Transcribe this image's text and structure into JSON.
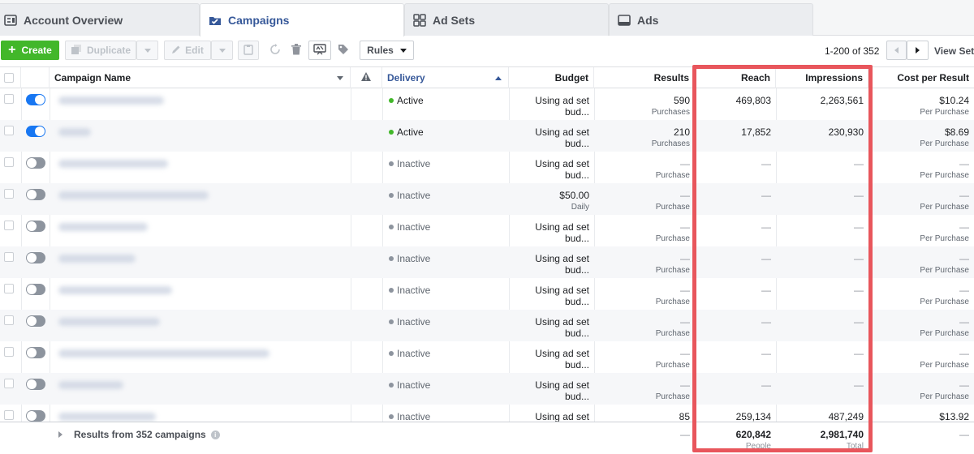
{
  "tabs": [
    {
      "label": "Account Overview",
      "icon": "account-overview-icon"
    },
    {
      "label": "Campaigns",
      "icon": "campaigns-icon"
    },
    {
      "label": "Ad Sets",
      "icon": "ad-sets-icon"
    },
    {
      "label": "Ads",
      "icon": "ads-icon"
    }
  ],
  "toolbar": {
    "create": "Create",
    "duplicate": "Duplicate",
    "edit": "Edit",
    "rules": "Rules",
    "pager": "1-200 of 352",
    "view_setup": "View Setup"
  },
  "columns": {
    "name": "Campaign Name",
    "delivery": "Delivery",
    "budget": "Budget",
    "results": "Results",
    "reach": "Reach",
    "impressions": "Impressions",
    "cost": "Cost per Result"
  },
  "rows": [
    {
      "on": true,
      "name_w": 130,
      "status": "Active",
      "budget": "Using ad set bud...",
      "budget_sub": "",
      "results": "590",
      "results_sub": "Purchases",
      "reach": "469,803",
      "impressions": "2,263,561",
      "cost": "$10.24",
      "cost_sub": "Per Purchase"
    },
    {
      "on": true,
      "name_w": 40,
      "status": "Active",
      "budget": "Using ad set bud...",
      "budget_sub": "",
      "results": "210",
      "results_sub": "Purchases",
      "reach": "17,852",
      "impressions": "230,930",
      "cost": "$8.69",
      "cost_sub": "Per Purchase"
    },
    {
      "on": false,
      "name_w": 135,
      "status": "Inactive",
      "budget": "Using ad set bud...",
      "budget_sub": "",
      "results": "—",
      "results_sub": "Purchase",
      "reach": "—",
      "impressions": "—",
      "cost": "—",
      "cost_sub": "Per Purchase"
    },
    {
      "on": false,
      "name_w": 185,
      "status": "Inactive",
      "budget": "$50.00",
      "budget_sub": "Daily",
      "results": "—",
      "results_sub": "Purchase",
      "reach": "—",
      "impressions": "—",
      "cost": "—",
      "cost_sub": "Per Purchase"
    },
    {
      "on": false,
      "name_w": 110,
      "status": "Inactive",
      "budget": "Using ad set bud...",
      "budget_sub": "",
      "results": "—",
      "results_sub": "Purchase",
      "reach": "—",
      "impressions": "—",
      "cost": "—",
      "cost_sub": "Per Purchase"
    },
    {
      "on": false,
      "name_w": 95,
      "status": "Inactive",
      "budget": "Using ad set bud...",
      "budget_sub": "",
      "results": "—",
      "results_sub": "Purchase",
      "reach": "—",
      "impressions": "—",
      "cost": "—",
      "cost_sub": "Per Purchase"
    },
    {
      "on": false,
      "name_w": 140,
      "status": "Inactive",
      "budget": "Using ad set bud...",
      "budget_sub": "",
      "results": "—",
      "results_sub": "Purchase",
      "reach": "—",
      "impressions": "—",
      "cost": "—",
      "cost_sub": "Per Purchase"
    },
    {
      "on": false,
      "name_w": 125,
      "status": "Inactive",
      "budget": "Using ad set bud...",
      "budget_sub": "",
      "results": "—",
      "results_sub": "Purchase",
      "reach": "—",
      "impressions": "—",
      "cost": "—",
      "cost_sub": "Per Purchase"
    },
    {
      "on": false,
      "name_w": 260,
      "status": "Inactive",
      "budget": "Using ad set bud...",
      "budget_sub": "",
      "results": "—",
      "results_sub": "Purchase",
      "reach": "—",
      "impressions": "—",
      "cost": "—",
      "cost_sub": "Per Purchase"
    },
    {
      "on": false,
      "name_w": 80,
      "status": "Inactive",
      "budget": "Using ad set bud...",
      "budget_sub": "",
      "results": "—",
      "results_sub": "Purchase",
      "reach": "—",
      "impressions": "—",
      "cost": "—",
      "cost_sub": "Per Purchase"
    },
    {
      "on": false,
      "name_w": 120,
      "status": "Inactive",
      "budget": "Using ad set bud...",
      "budget_sub": "",
      "results": "85",
      "results_sub": "",
      "reach": "259,134",
      "impressions": "487,249",
      "cost": "$13.92",
      "cost_sub": ""
    }
  ],
  "footer": {
    "label": "Results from 352 campaigns",
    "results": "—",
    "reach": "620,842",
    "reach_sub": "People",
    "impressions": "2,981,740",
    "impressions_sub": "Total",
    "cost": "—"
  },
  "colors": {
    "accent": "#365899",
    "create_green": "#42b72a",
    "toggle_on": "#1877f2",
    "highlight": "#e8565c"
  }
}
